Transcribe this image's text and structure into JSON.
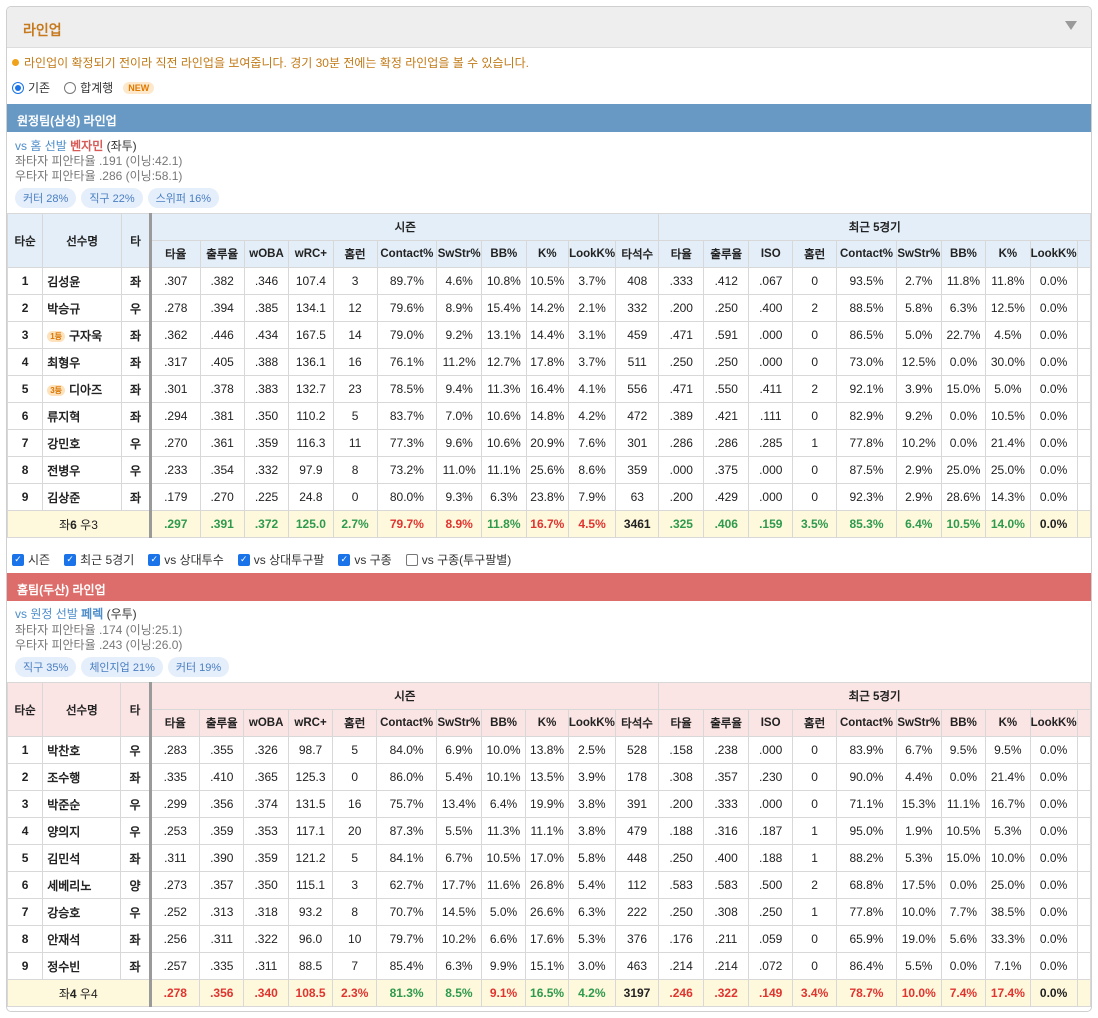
{
  "title": "라인업",
  "notice": "라인업이 확정되기 전이라 직전 라인업을 보여줍니다. 경기 30분 전에는 확정 라인업을 볼 수 있습니다.",
  "radios": {
    "opt1": "기존",
    "opt2": "합계행",
    "new": "NEW"
  },
  "headers": {
    "order": "타순",
    "player": "선수명",
    "bat": "타",
    "season": "시즌",
    "recent": "최근 5경기",
    "season_cols": [
      "타율",
      "출루율",
      "wOBA",
      "wRC+",
      "홈런",
      "Contact%",
      "SwStr%",
      "BB%",
      "K%",
      "LookK%",
      "타석수"
    ],
    "recent_cols": [
      "타율",
      "출루율",
      "ISO",
      "홈런",
      "Contact%",
      "SwStr%",
      "BB%",
      "K%",
      "LookK%"
    ]
  },
  "filters": [
    "시즌",
    "최근 5경기",
    "vs 상대투수",
    "vs 상대투구팔",
    "vs 구종",
    "vs 구종(투구팔별)"
  ],
  "away": {
    "title": "원정팀(삼성) 라인업",
    "starter_prefix": "vs 홈 선발 ",
    "starter_name": "벤자민",
    "starter_hand": "(좌투)",
    "split_left": "좌타자 피안타율 .191 (이닝:42.1)",
    "split_right": "우타자 피안타율 .286 (이닝:58.1)",
    "tags": [
      "커터 28%",
      "직구 22%",
      "스위퍼 16%"
    ],
    "rows": [
      {
        "n": "1",
        "name": "김성윤",
        "rank": "",
        "h": "좌",
        "s": [
          ".307",
          ".382",
          ".346",
          "107.4",
          "3",
          "89.7%",
          "4.6%",
          "10.8%",
          "10.5%",
          "3.7%",
          "408"
        ],
        "r": [
          ".333",
          ".412",
          ".067",
          "0",
          "93.5%",
          "2.7%",
          "11.8%",
          "11.8%",
          "0.0%"
        ]
      },
      {
        "n": "2",
        "name": "박승규",
        "rank": "",
        "h": "우",
        "s": [
          ".278",
          ".394",
          ".385",
          "134.1",
          "12",
          "79.6%",
          "8.9%",
          "15.4%",
          "14.2%",
          "2.1%",
          "332"
        ],
        "r": [
          ".200",
          ".250",
          ".400",
          "2",
          "88.5%",
          "5.8%",
          "6.3%",
          "12.5%",
          "0.0%"
        ]
      },
      {
        "n": "3",
        "name": "구자욱",
        "rank": "1등",
        "h": "좌",
        "s": [
          ".362",
          ".446",
          ".434",
          "167.5",
          "14",
          "79.0%",
          "9.2%",
          "13.1%",
          "14.4%",
          "3.1%",
          "459"
        ],
        "r": [
          ".471",
          ".591",
          ".000",
          "0",
          "86.5%",
          "5.0%",
          "22.7%",
          "4.5%",
          "0.0%"
        ]
      },
      {
        "n": "4",
        "name": "최형우",
        "rank": "",
        "h": "좌",
        "s": [
          ".317",
          ".405",
          ".388",
          "136.1",
          "16",
          "76.1%",
          "11.2%",
          "12.7%",
          "17.8%",
          "3.7%",
          "511"
        ],
        "r": [
          ".250",
          ".250",
          ".000",
          "0",
          "73.0%",
          "12.5%",
          "0.0%",
          "30.0%",
          "0.0%"
        ]
      },
      {
        "n": "5",
        "name": "디아즈",
        "rank": "3등",
        "h": "좌",
        "s": [
          ".301",
          ".378",
          ".383",
          "132.7",
          "23",
          "78.5%",
          "9.4%",
          "11.3%",
          "16.4%",
          "4.1%",
          "556"
        ],
        "r": [
          ".471",
          ".550",
          ".411",
          "2",
          "92.1%",
          "3.9%",
          "15.0%",
          "5.0%",
          "0.0%"
        ]
      },
      {
        "n": "6",
        "name": "류지혁",
        "rank": "",
        "h": "좌",
        "s": [
          ".294",
          ".381",
          ".350",
          "110.2",
          "5",
          "83.7%",
          "7.0%",
          "10.6%",
          "14.8%",
          "4.2%",
          "472"
        ],
        "r": [
          ".389",
          ".421",
          ".111",
          "0",
          "82.9%",
          "9.2%",
          "0.0%",
          "10.5%",
          "0.0%"
        ]
      },
      {
        "n": "7",
        "name": "강민호",
        "rank": "",
        "h": "우",
        "s": [
          ".270",
          ".361",
          ".359",
          "116.3",
          "11",
          "77.3%",
          "9.6%",
          "10.6%",
          "20.9%",
          "7.6%",
          "301"
        ],
        "r": [
          ".286",
          ".286",
          ".285",
          "1",
          "77.8%",
          "10.2%",
          "0.0%",
          "21.4%",
          "0.0%"
        ]
      },
      {
        "n": "8",
        "name": "전병우",
        "rank": "",
        "h": "우",
        "s": [
          ".233",
          ".354",
          ".332",
          "97.9",
          "8",
          "73.2%",
          "11.0%",
          "11.1%",
          "25.6%",
          "8.6%",
          "359"
        ],
        "r": [
          ".000",
          ".375",
          ".000",
          "0",
          "87.5%",
          "2.9%",
          "25.0%",
          "25.0%",
          "0.0%"
        ]
      },
      {
        "n": "9",
        "name": "김상준",
        "rank": "",
        "h": "좌",
        "s": [
          ".179",
          ".270",
          ".225",
          "24.8",
          "0",
          "80.0%",
          "9.3%",
          "6.3%",
          "23.8%",
          "7.9%",
          "63"
        ],
        "r": [
          ".200",
          ".429",
          ".000",
          "0",
          "92.3%",
          "2.9%",
          "28.6%",
          "14.3%",
          "0.0%"
        ]
      }
    ],
    "total": {
      "label_a": "좌",
      "label_b": "6",
      "label_c": " 우3",
      "s": [
        ".297",
        ".391",
        ".372",
        "125.0",
        "2.7%",
        "79.7%",
        "8.9%",
        "11.8%",
        "16.7%",
        "4.5%",
        "3461"
      ],
      "r": [
        ".325",
        ".406",
        ".159",
        "3.5%",
        "85.3%",
        "6.4%",
        "10.5%",
        "14.0%",
        "0.0%"
      ]
    }
  },
  "home": {
    "title": "홈팀(두산) 라인업",
    "starter_prefix": "vs 원정 선발 ",
    "starter_name": "페렉",
    "starter_hand": "(우투)",
    "split_left": "좌타자 피안타율 .174 (이닝:25.1)",
    "split_right": "우타자 피안타율 .243 (이닝:26.0)",
    "tags": [
      "직구 35%",
      "체인지업 21%",
      "커터 19%"
    ],
    "rows": [
      {
        "n": "1",
        "name": "박찬호",
        "rank": "",
        "h": "우",
        "s": [
          ".283",
          ".355",
          ".326",
          "98.7",
          "5",
          "84.0%",
          "6.9%",
          "10.0%",
          "13.8%",
          "2.5%",
          "528"
        ],
        "r": [
          ".158",
          ".238",
          ".000",
          "0",
          "83.9%",
          "6.7%",
          "9.5%",
          "9.5%",
          "0.0%"
        ]
      },
      {
        "n": "2",
        "name": "조수행",
        "rank": "",
        "h": "좌",
        "s": [
          ".335",
          ".410",
          ".365",
          "125.3",
          "0",
          "86.0%",
          "5.4%",
          "10.1%",
          "13.5%",
          "3.9%",
          "178"
        ],
        "r": [
          ".308",
          ".357",
          ".230",
          "0",
          "90.0%",
          "4.4%",
          "0.0%",
          "21.4%",
          "0.0%"
        ]
      },
      {
        "n": "3",
        "name": "박준순",
        "rank": "",
        "h": "우",
        "s": [
          ".299",
          ".356",
          ".374",
          "131.5",
          "16",
          "75.7%",
          "13.4%",
          "6.4%",
          "19.9%",
          "3.8%",
          "391"
        ],
        "r": [
          ".200",
          ".333",
          ".000",
          "0",
          "71.1%",
          "15.3%",
          "11.1%",
          "16.7%",
          "0.0%"
        ]
      },
      {
        "n": "4",
        "name": "양의지",
        "rank": "",
        "h": "우",
        "s": [
          ".253",
          ".359",
          ".353",
          "117.1",
          "20",
          "87.3%",
          "5.5%",
          "11.3%",
          "11.1%",
          "3.8%",
          "479"
        ],
        "r": [
          ".188",
          ".316",
          ".187",
          "1",
          "95.0%",
          "1.9%",
          "10.5%",
          "5.3%",
          "0.0%"
        ]
      },
      {
        "n": "5",
        "name": "김민석",
        "rank": "",
        "h": "좌",
        "s": [
          ".311",
          ".390",
          ".359",
          "121.2",
          "5",
          "84.1%",
          "6.7%",
          "10.5%",
          "17.0%",
          "5.8%",
          "448"
        ],
        "r": [
          ".250",
          ".400",
          ".188",
          "1",
          "88.2%",
          "5.3%",
          "15.0%",
          "10.0%",
          "0.0%"
        ]
      },
      {
        "n": "6",
        "name": "세베리노",
        "rank": "",
        "h": "양",
        "s": [
          ".273",
          ".357",
          ".350",
          "115.1",
          "3",
          "62.7%",
          "17.7%",
          "11.6%",
          "26.8%",
          "5.4%",
          "112"
        ],
        "r": [
          ".583",
          ".583",
          ".500",
          "2",
          "68.8%",
          "17.5%",
          "0.0%",
          "25.0%",
          "0.0%"
        ]
      },
      {
        "n": "7",
        "name": "강승호",
        "rank": "",
        "h": "우",
        "s": [
          ".252",
          ".313",
          ".318",
          "93.2",
          "8",
          "70.7%",
          "14.5%",
          "5.0%",
          "26.6%",
          "6.3%",
          "222"
        ],
        "r": [
          ".250",
          ".308",
          ".250",
          "1",
          "77.8%",
          "10.0%",
          "7.7%",
          "38.5%",
          "0.0%"
        ]
      },
      {
        "n": "8",
        "name": "안재석",
        "rank": "",
        "h": "좌",
        "s": [
          ".256",
          ".311",
          ".322",
          "96.0",
          "10",
          "79.7%",
          "10.2%",
          "6.6%",
          "17.6%",
          "5.3%",
          "376"
        ],
        "r": [
          ".176",
          ".211",
          ".059",
          "0",
          "65.9%",
          "19.0%",
          "5.6%",
          "33.3%",
          "0.0%"
        ]
      },
      {
        "n": "9",
        "name": "정수빈",
        "rank": "",
        "h": "좌",
        "s": [
          ".257",
          ".335",
          ".311",
          "88.5",
          "7",
          "85.4%",
          "6.3%",
          "9.9%",
          "15.1%",
          "3.0%",
          "463"
        ],
        "r": [
          ".214",
          ".214",
          ".072",
          "0",
          "86.4%",
          "5.5%",
          "0.0%",
          "7.1%",
          "0.0%"
        ]
      }
    ],
    "total": {
      "label_a": "좌",
      "label_b": "4",
      "label_c": " 우4",
      "s": [
        ".278",
        ".356",
        ".340",
        "108.5",
        "2.3%",
        "81.3%",
        "8.5%",
        "9.1%",
        "16.5%",
        "4.2%",
        "3197"
      ],
      "r": [
        ".246",
        ".322",
        ".149",
        "3.4%",
        "78.7%",
        "10.0%",
        "7.4%",
        "17.4%",
        "0.0%"
      ]
    }
  },
  "colors": {
    "away_bar": "#6899c5",
    "home_bar": "#dc6d6a",
    "good": "#2e9a4c",
    "bad": "#e0342f"
  },
  "icons": {
    "collapse": "caret-down-icon"
  }
}
